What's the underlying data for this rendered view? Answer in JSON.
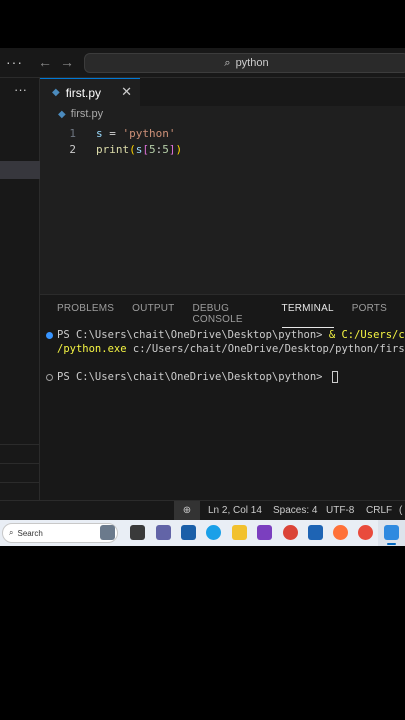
{
  "titlebar": {
    "more_icon": "more-horizontal-icon",
    "back_icon": "arrow-left-icon",
    "forward_icon": "arrow-right-icon",
    "search_glyph": "⌕",
    "command_center_label": "python"
  },
  "sidebar": {
    "more_glyph": "···"
  },
  "tab": {
    "label": "first.py",
    "icon_glyph": "◆",
    "close_glyph": "✕"
  },
  "breadcrumb": {
    "file": "first.py"
  },
  "editor": {
    "lines": [
      {
        "number": "1"
      },
      {
        "number": "2"
      }
    ],
    "line1": {
      "var": "s",
      "op": " = ",
      "str": "'python'"
    },
    "line2": {
      "fn": "print",
      "open1": "(",
      "var": "s",
      "open2": "[",
      "start": "5",
      "colon": ":",
      "end": "5",
      "close2": "]",
      "close1": ")"
    }
  },
  "panel": {
    "tabs": [
      "PROBLEMS",
      "OUTPUT",
      "DEBUG CONSOLE",
      "TERMINAL",
      "PORTS"
    ],
    "active_tab": "TERMINAL",
    "terminal": {
      "line1_prompt": "PS C:\\Users\\chait\\OneDrive\\Desktop\\python> ",
      "line1_cmd": "& C:/Users/chait",
      "line2_cmd": "/python.exe",
      "line2_rest": " c:/Users/chait/OneDrive/Desktop/python/first.py",
      "line3_prompt": "PS C:\\Users\\chait\\OneDrive\\Desktop\\python> "
    }
  },
  "statusbar": {
    "zoom_glyph": "⊕",
    "position": "Ln 2, Col 14",
    "spaces": "Spaces: 4",
    "encoding": "UTF-8",
    "eol": "CRLF",
    "extra": "("
  },
  "taskbar": {
    "search_glyph": "⌕",
    "search_label": "Search",
    "colors": {
      "accent": "#0067c0",
      "vscode": "#2f8ae0",
      "edge": "#1aa0e8",
      "explorer": "#f2c12e",
      "chrome": "#db4437",
      "firefox": "#ff7139"
    }
  }
}
